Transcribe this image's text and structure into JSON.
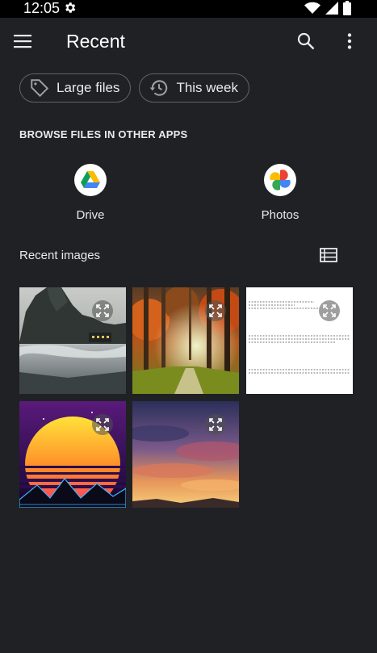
{
  "status": {
    "time": "12:05"
  },
  "header": {
    "title": "Recent"
  },
  "chips": [
    {
      "label": "Large files",
      "icon": "tag-icon"
    },
    {
      "label": "This week",
      "icon": "history-icon"
    }
  ],
  "browse": {
    "title": "BROWSE FILES IN OTHER APPS",
    "apps": [
      {
        "label": "Drive"
      },
      {
        "label": "Photos"
      }
    ]
  },
  "recent": {
    "title": "Recent images"
  },
  "colors": {
    "background": "#202124",
    "status_bar": "#000000",
    "text": "#e8eaed",
    "chip_border": "#5f6368"
  }
}
